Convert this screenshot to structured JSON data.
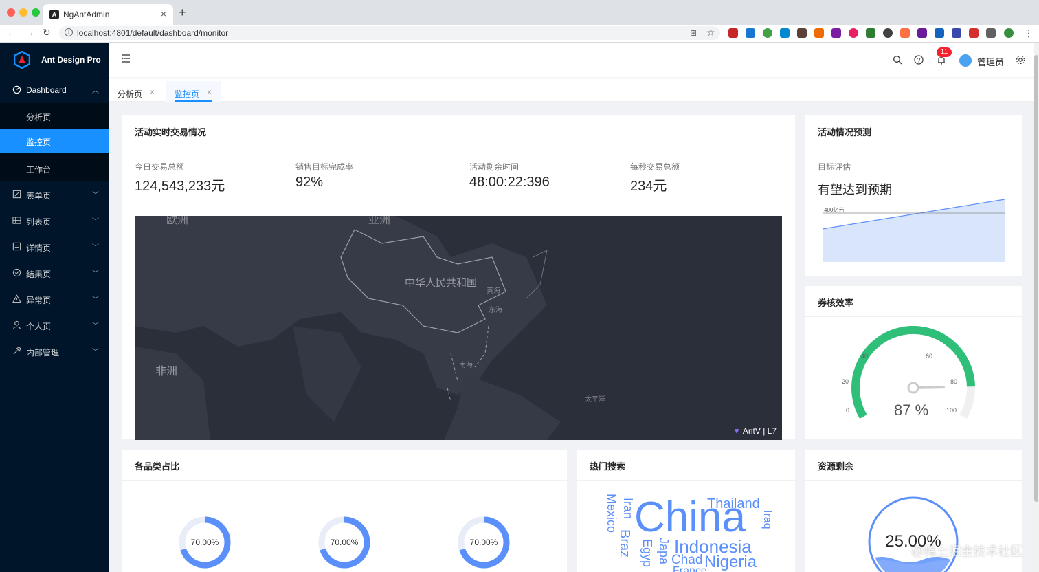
{
  "browser": {
    "tab_title": "NgAntAdmin",
    "url": "localhost:4801/default/dashboard/monitor"
  },
  "sidebar": {
    "logo_text": "Ant Design Pro",
    "items": [
      {
        "label": "Dashboard",
        "icon": "dashboard-icon"
      },
      {
        "label": "分析页"
      },
      {
        "label": "监控页"
      },
      {
        "label": "工作台"
      },
      {
        "label": "表单页",
        "icon": "form-icon"
      },
      {
        "label": "列表页",
        "icon": "table-icon"
      },
      {
        "label": "详情页",
        "icon": "profile-icon"
      },
      {
        "label": "结果页",
        "icon": "check-circle-icon"
      },
      {
        "label": "异常页",
        "icon": "warning-icon"
      },
      {
        "label": "个人页",
        "icon": "user-icon"
      },
      {
        "label": "内部管理",
        "icon": "tool-icon"
      }
    ]
  },
  "header": {
    "notification_count": "11",
    "username": "管理员"
  },
  "route_tabs": [
    {
      "label": "分析页"
    },
    {
      "label": "监控页"
    }
  ],
  "realtime": {
    "title": "活动实时交易情况",
    "stats": [
      {
        "label": "今日交易总额",
        "value": "124,543,233元"
      },
      {
        "label": "销售目标完成率",
        "value": "92%"
      },
      {
        "label": "活动剩余时间",
        "value": "48:00:22:396"
      },
      {
        "label": "每秒交易总额",
        "value": "234元"
      }
    ],
    "map_labels": {
      "europe": "欧洲",
      "asia": "亚洲",
      "china": "中华人民共和国",
      "yellow_sea": "黄海",
      "east_sea": "东海",
      "south_sea": "南海",
      "africa": "非洲",
      "pacific": "太平洋"
    },
    "map_credit": "AntV | L7"
  },
  "forecast": {
    "title": "活动情况预测",
    "label": "目标评估",
    "value": "有望达到预期",
    "target_label": "400亿元"
  },
  "efficiency": {
    "title": "券核效率",
    "gauge_value": 87,
    "gauge_text": "87 %",
    "ticks": [
      "0",
      "20",
      "40",
      "60",
      "80",
      "100"
    ]
  },
  "category": {
    "title": "各品类占比",
    "rings": [
      "70.00%",
      "70.00%",
      "70.00%"
    ]
  },
  "hot_search": {
    "title": "热门搜索",
    "words": [
      "China",
      "Thailand",
      "Indonesia",
      "Nigeria",
      "Chad",
      "France",
      "Iran",
      "Braz",
      "Mexico",
      "Egyp",
      "Japa",
      "Iraq"
    ]
  },
  "resource": {
    "title": "资源剩余",
    "value": "25.00%"
  },
  "watermark": "@稀土掘金技术社区",
  "colors": {
    "primary": "#1890ff",
    "sider_bg": "#001529",
    "gauge_green": "#30bf78",
    "ring_blue": "#5b8ff9"
  }
}
